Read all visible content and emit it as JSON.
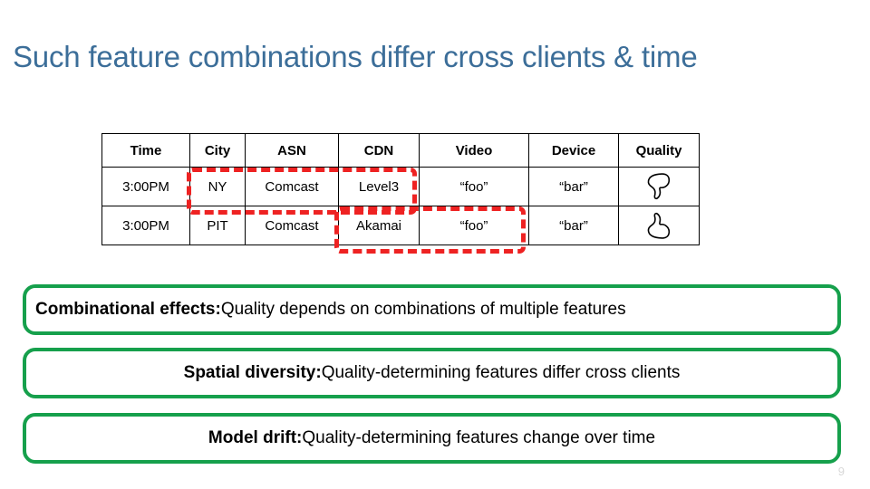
{
  "slide": {
    "title": "Such feature combinations differ cross clients & time",
    "title_color": "#3c6e99",
    "page_number": "9"
  },
  "table": {
    "headers": [
      "Time",
      "City",
      "ASN",
      "CDN",
      "Video",
      "Device",
      "Quality"
    ],
    "rows": [
      {
        "time": "3:00PM",
        "city": "NY",
        "asn": "Comcast",
        "cdn": "Level3",
        "video": "“foo”",
        "device": "“bar”",
        "quality_icon": "thumbs-down-icon"
      },
      {
        "time": "3:00PM",
        "city": "PIT",
        "asn": "Comcast",
        "cdn": "Akamai",
        "video": "“foo”",
        "device": "“bar”",
        "quality_icon": "thumbs-up-icon"
      }
    ]
  },
  "highlights": {
    "color": "#ee2222",
    "row1_columns": [
      "City",
      "ASN",
      "CDN"
    ],
    "row2_columns": [
      "CDN",
      "Video"
    ]
  },
  "callouts": {
    "accent_color": "#16a04c",
    "items": [
      {
        "lead": "Combinational effects:",
        "rest": " Quality depends on combinations of multiple features"
      },
      {
        "lead": "Spatial diversity:",
        "rest": " Quality-determining features differ cross clients"
      },
      {
        "lead": "Model drift:",
        "rest": " Quality-determining features change over time"
      }
    ]
  }
}
